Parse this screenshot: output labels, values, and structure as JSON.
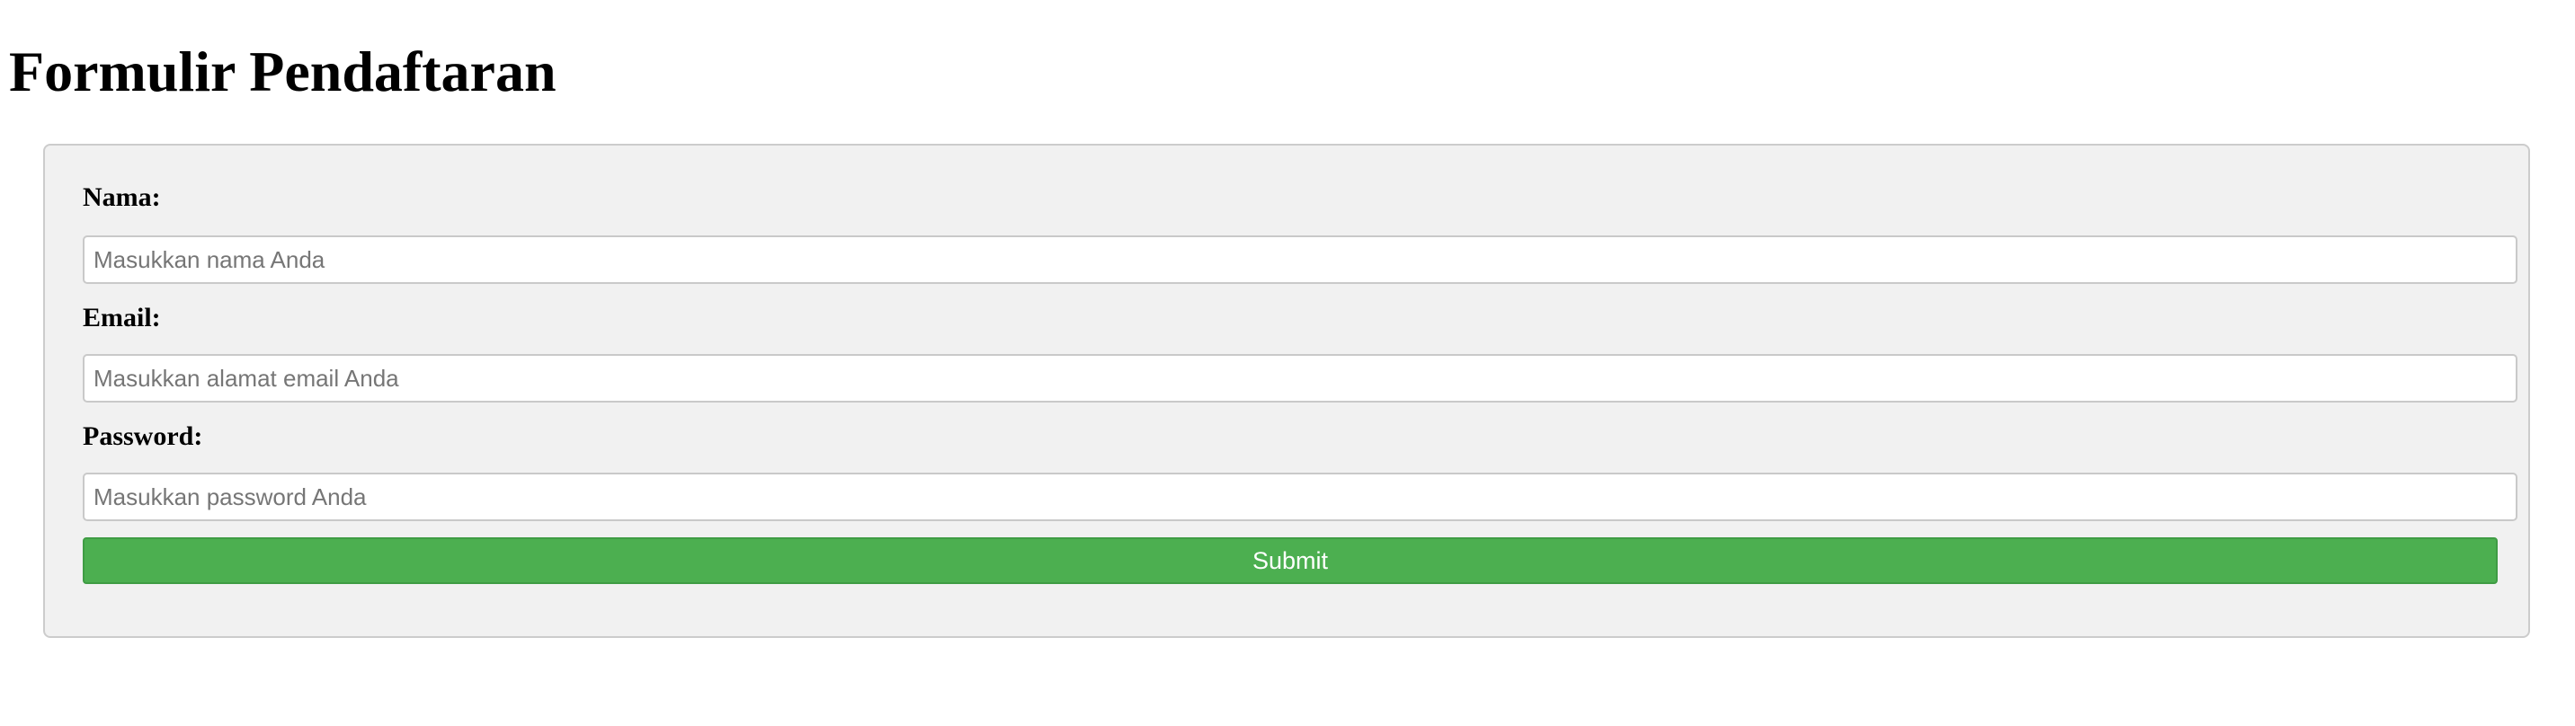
{
  "page": {
    "title": "Formulir Pendaftaran"
  },
  "form": {
    "fields": [
      {
        "label": "Nama:",
        "placeholder": "Masukkan nama Anda",
        "value": ""
      },
      {
        "label": "Email:",
        "placeholder": "Masukkan alamat email Anda",
        "value": ""
      },
      {
        "label": "Password:",
        "placeholder": "Masukkan password Anda",
        "value": ""
      }
    ],
    "submit_label": "Submit"
  },
  "colors": {
    "panel_background": "#f1f1f1",
    "panel_border": "#cccccc",
    "submit_background": "#4caf50",
    "submit_text": "#ffffff",
    "placeholder_text": "#767676"
  }
}
